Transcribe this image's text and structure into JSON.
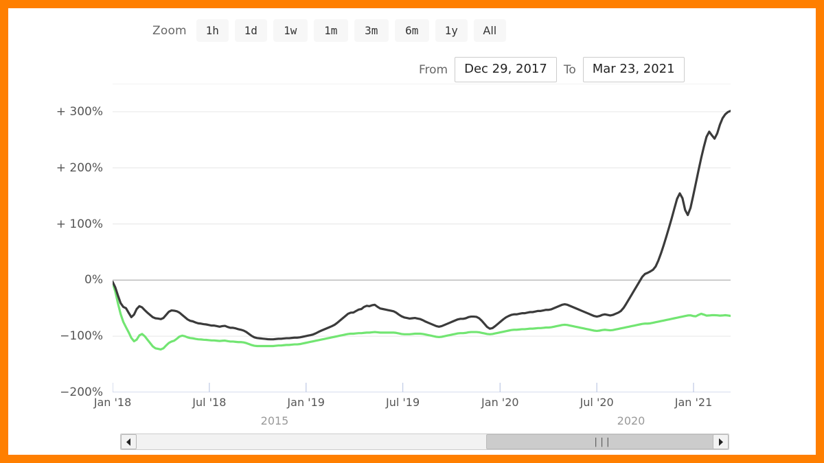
{
  "theme": {
    "border_color": "#ff7f00",
    "series_primary_color": "#3b3b3b",
    "series_secondary_color": "#72e572",
    "grid_color": "#e6e6e6",
    "zero_line_color": "#bbbbbb",
    "axis_color": "#c7d0e8",
    "button_bg": "#f7f7f7"
  },
  "range_selector": {
    "label": "Zoom",
    "buttons": [
      {
        "id": "1h",
        "label": "1h",
        "selected": false
      },
      {
        "id": "1d",
        "label": "1d",
        "selected": false
      },
      {
        "id": "1w",
        "label": "1w",
        "selected": false
      },
      {
        "id": "1m",
        "label": "1m",
        "selected": false
      },
      {
        "id": "3m",
        "label": "3m",
        "selected": false
      },
      {
        "id": "6m",
        "label": "6m",
        "selected": false
      },
      {
        "id": "1y",
        "label": "1y",
        "selected": false
      },
      {
        "id": "all",
        "label": "All",
        "selected": false
      }
    ],
    "from_label": "From",
    "from_value": "Dec 29, 2017",
    "to_label": "To",
    "to_value": "Mar 23, 2021"
  },
  "navigator": {
    "year_labels": [
      "2015",
      "2020"
    ],
    "scroll_left_icon": "◀",
    "scroll_right_icon": "▶",
    "grip_glyph": "|||"
  },
  "chart_data": {
    "type": "line",
    "title": "",
    "subtitle": "",
    "xlabel": "",
    "ylabel": "",
    "grid": true,
    "legend": "none",
    "ylim": [
      -200,
      350
    ],
    "ytick_labels": [
      "+ 300%",
      "+ 200%",
      "+ 100%",
      "0%",
      "−100%",
      "−200%"
    ],
    "yticks": [
      300,
      200,
      100,
      0,
      -100,
      -200
    ],
    "xtick_labels": [
      "Jan '18",
      "Jul '18",
      "Jan '19",
      "Jul '19",
      "Jan '20",
      "Jul '20",
      "Jan '21"
    ],
    "xticks": [
      0,
      0.1565,
      0.313,
      0.4695,
      0.627,
      0.7835,
      0.94
    ],
    "x_range": [
      "Dec 29, 2017",
      "Mar 23, 2021"
    ],
    "series": [
      {
        "name": "primary",
        "color": "#3b3b3b",
        "values": [
          0,
          -12,
          -28,
          -42,
          -52,
          -45,
          -58,
          -72,
          -62,
          -50,
          -44,
          -48,
          -54,
          -58,
          -62,
          -66,
          -70,
          -66,
          -72,
          -68,
          -62,
          -56,
          -52,
          -56,
          -54,
          -58,
          -62,
          -66,
          -70,
          -74,
          -72,
          -76,
          -78,
          -76,
          -80,
          -78,
          -80,
          -82,
          -80,
          -82,
          -84,
          -82,
          -80,
          -84,
          -86,
          -84,
          -86,
          -88,
          -88,
          -90,
          -92,
          -96,
          -100,
          -102,
          -104,
          -103,
          -105,
          -104,
          -106,
          -105,
          -106,
          -105,
          -104,
          -105,
          -104,
          -103,
          -104,
          -103,
          -102,
          -103,
          -102,
          -101,
          -100,
          -99,
          -98,
          -97,
          -95,
          -92,
          -90,
          -88,
          -86,
          -84,
          -82,
          -80,
          -76,
          -72,
          -68,
          -64,
          -60,
          -56,
          -60,
          -55,
          -50,
          -55,
          -46,
          -44,
          -49,
          -44,
          -42,
          -48,
          -52,
          -50,
          -54,
          -52,
          -56,
          -54,
          -58,
          -62,
          -64,
          -68,
          -66,
          -70,
          -68,
          -66,
          -70,
          -68,
          -72,
          -74,
          -76,
          -78,
          -80,
          -82,
          -84,
          -82,
          -80,
          -78,
          -76,
          -74,
          -72,
          -70,
          -68,
          -70,
          -68,
          -66,
          -64,
          -66,
          -64,
          -68,
          -72,
          -78,
          -84,
          -88,
          -86,
          -82,
          -78,
          -74,
          -70,
          -66,
          -64,
          -62,
          -60,
          -62,
          -60,
          -58,
          -60,
          -58,
          -56,
          -58,
          -56,
          -54,
          -56,
          -54,
          -52,
          -54,
          -52,
          -50,
          -48,
          -46,
          -44,
          -42,
          -44,
          -46,
          -48,
          -50,
          -52,
          -54,
          -56,
          -58,
          -60,
          -62,
          -64,
          -66,
          -64,
          -62,
          -60,
          -62,
          -64,
          -62,
          -60,
          -58,
          -56,
          -50,
          -42,
          -34,
          -26,
          -18,
          -10,
          -2,
          6,
          14,
          10,
          18,
          16,
          24,
          34,
          48,
          62,
          78,
          94,
          110,
          128,
          146,
          160,
          152,
          120,
          108,
          128,
          150,
          172,
          196,
          218,
          238,
          256,
          272,
          258,
          244,
          262,
          278,
          290,
          296,
          300,
          302
        ]
      },
      {
        "name": "secondary",
        "color": "#72e572",
        "values": [
          0,
          -20,
          -42,
          -62,
          -76,
          -84,
          -92,
          -104,
          -112,
          -108,
          -96,
          -94,
          -100,
          -106,
          -112,
          -118,
          -124,
          -120,
          -126,
          -122,
          -116,
          -112,
          -108,
          -110,
          -104,
          -100,
          -98,
          -100,
          -102,
          -104,
          -103,
          -105,
          -106,
          -105,
          -107,
          -106,
          -107,
          -108,
          -107,
          -108,
          -109,
          -108,
          -107,
          -109,
          -110,
          -109,
          -110,
          -111,
          -110,
          -111,
          -112,
          -114,
          -116,
          -117,
          -118,
          -117,
          -118,
          -117,
          -118,
          -117,
          -118,
          -117,
          -116,
          -117,
          -116,
          -115,
          -116,
          -115,
          -114,
          -115,
          -114,
          -113,
          -112,
          -111,
          -110,
          -109,
          -108,
          -107,
          -106,
          -105,
          -104,
          -103,
          -102,
          -101,
          -100,
          -99,
          -98,
          -97,
          -96,
          -95,
          -96,
          -95,
          -94,
          -95,
          -94,
          -93,
          -94,
          -93,
          -92,
          -93,
          -94,
          -93,
          -94,
          -93,
          -94,
          -93,
          -94,
          -95,
          -96,
          -97,
          -96,
          -97,
          -96,
          -95,
          -96,
          -95,
          -96,
          -97,
          -98,
          -99,
          -100,
          -101,
          -102,
          -101,
          -100,
          -99,
          -98,
          -97,
          -96,
          -95,
          -94,
          -95,
          -94,
          -93,
          -92,
          -93,
          -92,
          -93,
          -94,
          -95,
          -96,
          -97,
          -96,
          -95,
          -94,
          -93,
          -92,
          -91,
          -90,
          -89,
          -88,
          -89,
          -88,
          -87,
          -88,
          -87,
          -86,
          -87,
          -86,
          -85,
          -86,
          -85,
          -84,
          -85,
          -84,
          -83,
          -82,
          -81,
          -80,
          -79,
          -80,
          -81,
          -82,
          -83,
          -84,
          -85,
          -86,
          -87,
          -88,
          -89,
          -90,
          -91,
          -90,
          -89,
          -88,
          -89,
          -90,
          -89,
          -88,
          -87,
          -86,
          -85,
          -84,
          -83,
          -82,
          -81,
          -80,
          -79,
          -78,
          -77,
          -78,
          -77,
          -76,
          -75,
          -74,
          -73,
          -72,
          -71,
          -70,
          -69,
          -68,
          -67,
          -66,
          -65,
          -64,
          -63,
          -62,
          -64,
          -66,
          -62,
          -58,
          -62,
          -64,
          -63,
          -62,
          -63,
          -62,
          -64,
          -63,
          -62,
          -63,
          -64
        ]
      }
    ]
  }
}
